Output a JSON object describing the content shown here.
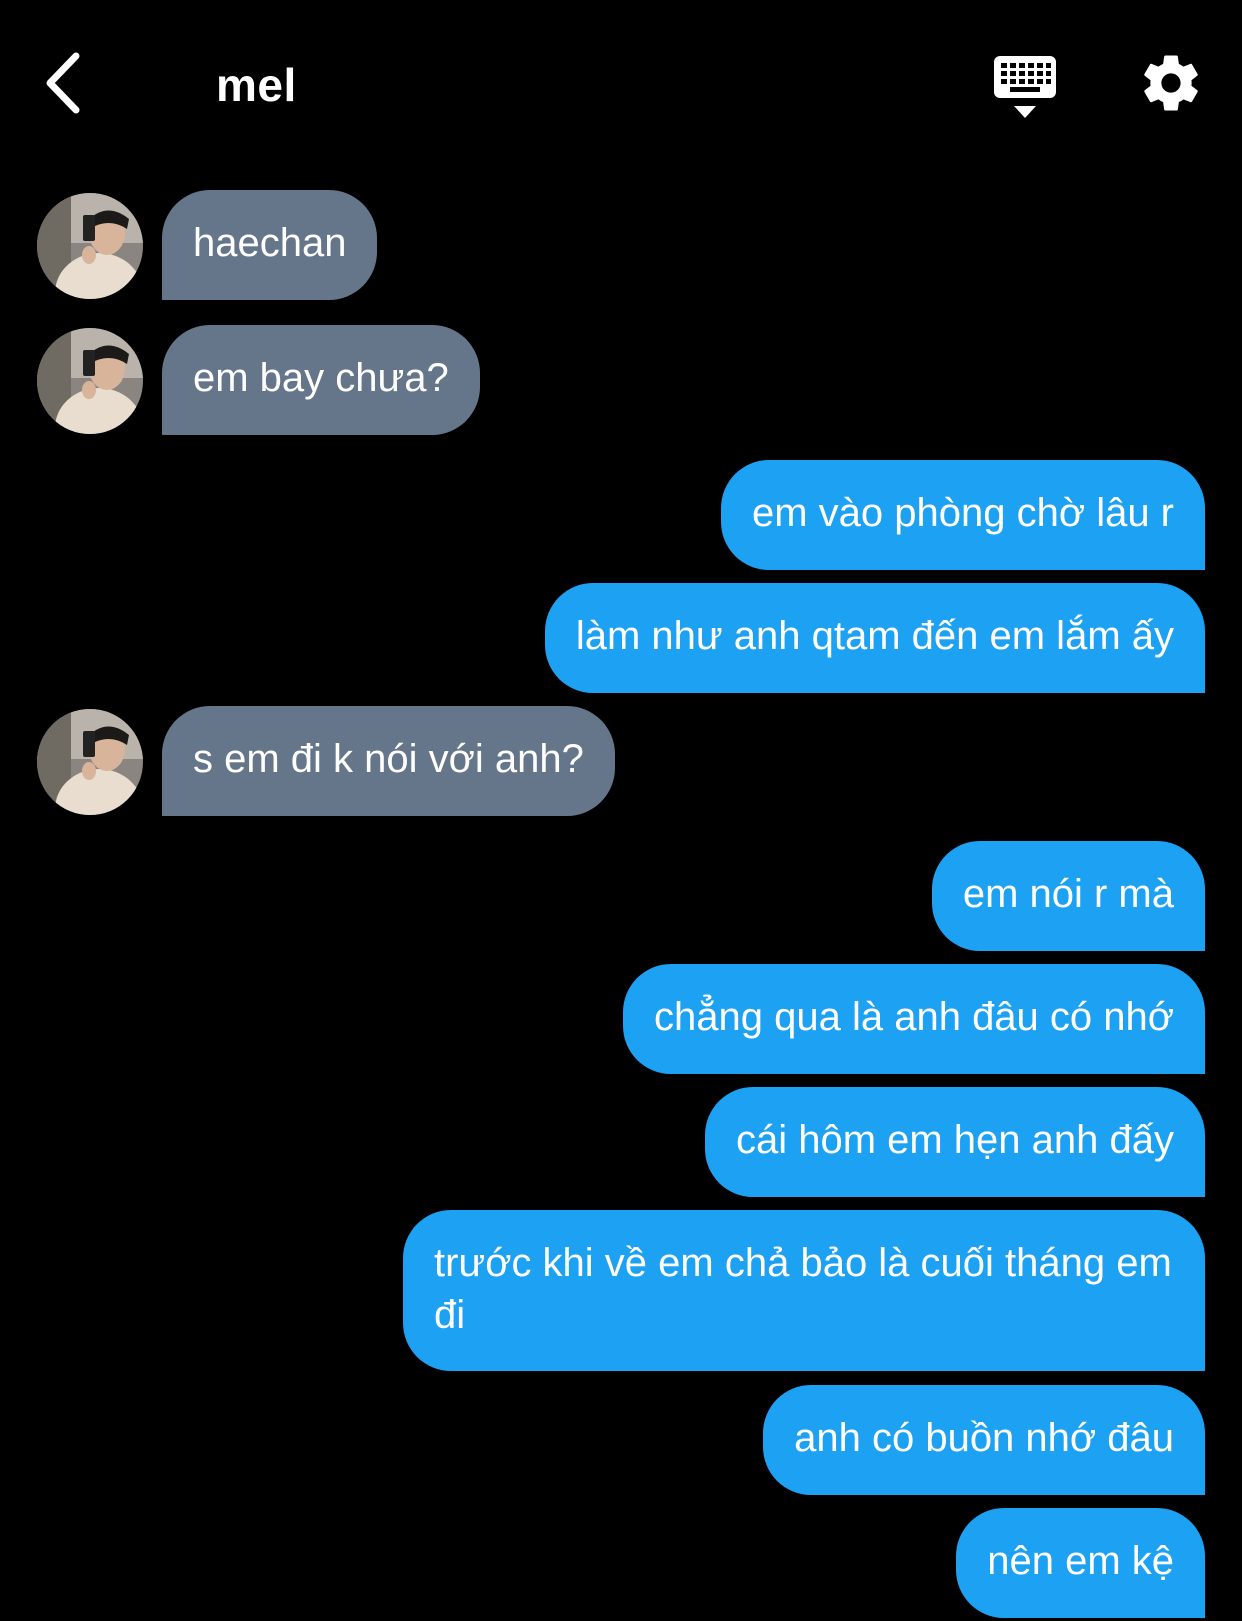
{
  "header": {
    "title": "mel",
    "back_icon": "chevron-left-icon",
    "keyboard_icon": "keyboard-hide-icon",
    "settings_icon": "gear-icon"
  },
  "colors": {
    "background": "#000000",
    "incoming_bubble": "#66768a",
    "outgoing_bubble": "#1da1f2",
    "text": "#ffffff"
  },
  "messages": [
    {
      "direction": "incoming",
      "text": "haechan"
    },
    {
      "direction": "incoming",
      "text": "em bay chưa?"
    },
    {
      "direction": "outgoing",
      "text": "em vào phòng chờ lâu r"
    },
    {
      "direction": "outgoing",
      "text": "làm như anh qtam đến em lắm ấy"
    },
    {
      "direction": "incoming",
      "text": "s em đi k nói với anh?"
    },
    {
      "direction": "outgoing",
      "text": "em nói r mà"
    },
    {
      "direction": "outgoing",
      "text": "chẳng qua là anh đâu có nhớ"
    },
    {
      "direction": "outgoing",
      "text": "cái hôm em hẹn anh đấy"
    },
    {
      "direction": "outgoing",
      "text": "trước khi về em chả bảo là cuối tháng em đi"
    },
    {
      "direction": "outgoing",
      "text": "anh có buồn nhớ đâu"
    },
    {
      "direction": "outgoing",
      "text": "nên em kệ"
    }
  ]
}
